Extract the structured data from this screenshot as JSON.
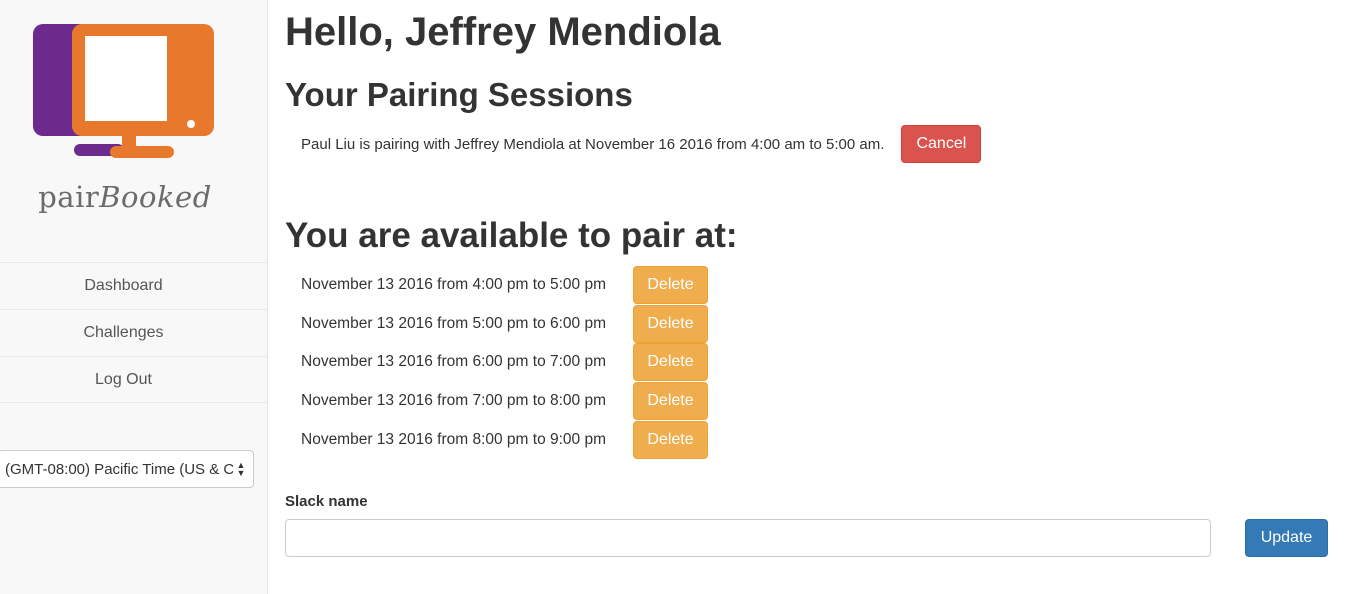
{
  "brand": {
    "name_part1": "pair",
    "name_part2": "Booked"
  },
  "colors": {
    "logo_purple": "#6b2a8c",
    "logo_orange": "#e8782c",
    "cancel": "#d9534f",
    "delete": "#f0ad4e",
    "update": "#337ab7"
  },
  "nav": {
    "items": [
      "Dashboard",
      "Challenges",
      "Log Out"
    ]
  },
  "timezone": {
    "selected": "(GMT-08:00) Pacific Time (US & C"
  },
  "main": {
    "greeting": "Hello, Jeffrey Mendiola",
    "sessions_title": "Your Pairing Sessions",
    "session": {
      "text": "Paul Liu is pairing with Jeffrey Mendiola at November 16 2016 from 4:00 am to 5:00 am.",
      "cancel_label": "Cancel"
    },
    "available_title": "You are available to pair at:",
    "slots": [
      {
        "text": "November 13 2016 from 4:00 pm to 5:00 pm",
        "delete_label": "Delete"
      },
      {
        "text": "November 13 2016 from 5:00 pm to 6:00 pm",
        "delete_label": "Delete"
      },
      {
        "text": "November 13 2016 from 6:00 pm to 7:00 pm",
        "delete_label": "Delete"
      },
      {
        "text": "November 13 2016 from 7:00 pm to 8:00 pm",
        "delete_label": "Delete"
      },
      {
        "text": "November 13 2016 from 8:00 pm to 9:00 pm",
        "delete_label": "Delete"
      }
    ],
    "slack": {
      "label": "Slack name",
      "value": "",
      "placeholder": "",
      "update_label": "Update"
    }
  }
}
